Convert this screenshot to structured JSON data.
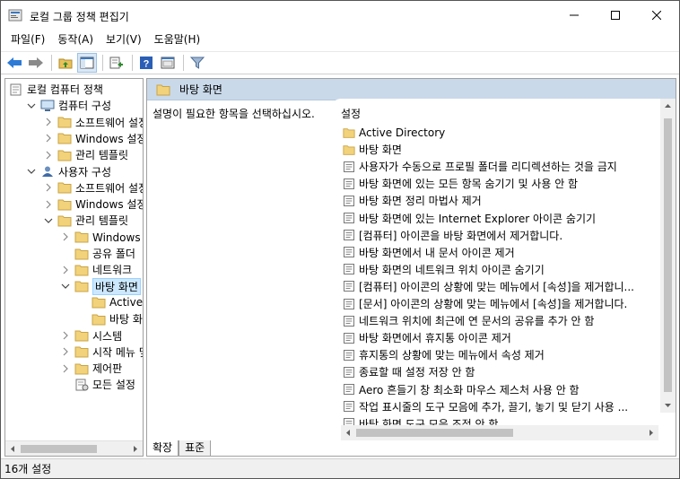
{
  "window": {
    "title": "로컬 그룹 정책 편집기"
  },
  "menu": [
    "파일(F)",
    "동작(A)",
    "보기(V)",
    "도움말(H)"
  ],
  "toolbar": {
    "icons": [
      "back-arrow-icon",
      "forward-arrow-icon",
      "up-folder-icon",
      "show-hide-tree-icon",
      "export-list-icon",
      "help-icon",
      "properties-icon",
      "filter-icon"
    ]
  },
  "tree": {
    "items": [
      {
        "label": "로컬 컴퓨터 정책",
        "indent": 0,
        "chev": "",
        "icon": "policy"
      },
      {
        "label": "컴퓨터 구성",
        "indent": 1,
        "chev": "down",
        "icon": "computer"
      },
      {
        "label": "소프트웨어 설정",
        "indent": 2,
        "chev": "right",
        "icon": "folder"
      },
      {
        "label": "Windows 설정",
        "indent": 2,
        "chev": "right",
        "icon": "folder"
      },
      {
        "label": "관리 템플릿",
        "indent": 2,
        "chev": "right",
        "icon": "folder"
      },
      {
        "label": "사용자 구성",
        "indent": 1,
        "chev": "down",
        "icon": "user"
      },
      {
        "label": "소프트웨어 설정",
        "indent": 2,
        "chev": "right",
        "icon": "folder"
      },
      {
        "label": "Windows 설정",
        "indent": 2,
        "chev": "right",
        "icon": "folder"
      },
      {
        "label": "관리 템플릿",
        "indent": 2,
        "chev": "down",
        "icon": "folder"
      },
      {
        "label": "Windows 구성",
        "indent": 3,
        "chev": "right",
        "icon": "folder"
      },
      {
        "label": "공유 폴더",
        "indent": 3,
        "chev": "",
        "icon": "folder"
      },
      {
        "label": "네트워크",
        "indent": 3,
        "chev": "right",
        "icon": "folder"
      },
      {
        "label": "바탕 화면",
        "indent": 3,
        "chev": "down",
        "icon": "folder",
        "selected": true
      },
      {
        "label": "Active Dir",
        "indent": 4,
        "chev": "",
        "icon": "folder"
      },
      {
        "label": "바탕 화면",
        "indent": 4,
        "chev": "",
        "icon": "folder"
      },
      {
        "label": "시스템",
        "indent": 3,
        "chev": "right",
        "icon": "folder"
      },
      {
        "label": "시작 메뉴 및",
        "indent": 3,
        "chev": "right",
        "icon": "folder"
      },
      {
        "label": "제어판",
        "indent": 3,
        "chev": "right",
        "icon": "folder"
      },
      {
        "label": "모든 설정",
        "indent": 3,
        "chev": "",
        "icon": "allsettings"
      }
    ]
  },
  "right": {
    "header": "바탕 화면",
    "description": "설명이 필요한 항목을 선택하십시오.",
    "list_header": "설정",
    "items": [
      {
        "label": "Active Directory",
        "icon": "folder"
      },
      {
        "label": "바탕 화면",
        "icon": "folder"
      },
      {
        "label": "사용자가 수동으로 프로필 폴더를 리디렉션하는 것을 금지",
        "icon": "setting"
      },
      {
        "label": "바탕 화면에 있는 모든 항목 숨기기 및 사용 안 함",
        "icon": "setting"
      },
      {
        "label": "바탕 화면 정리 마법사 제거",
        "icon": "setting"
      },
      {
        "label": "바탕 화면에 있는 Internet Explorer 아이콘 숨기기",
        "icon": "setting"
      },
      {
        "label": "[컴퓨터] 아이콘을 바탕 화면에서 제거합니다.",
        "icon": "setting"
      },
      {
        "label": "바탕 화면에서 내 문서 아이콘 제거",
        "icon": "setting"
      },
      {
        "label": "바탕 화면의 네트워크 위치 아이콘 숨기기",
        "icon": "setting"
      },
      {
        "label": "[컴퓨터] 아이콘의 상황에 맞는 메뉴에서 [속성]을 제거합니...",
        "icon": "setting"
      },
      {
        "label": "[문서] 아이콘의 상황에 맞는 메뉴에서 [속성]을 제거합니다.",
        "icon": "setting"
      },
      {
        "label": "네트워크 위치에 최근에 연 문서의 공유를 추가 안 함",
        "icon": "setting"
      },
      {
        "label": "바탕 화면에서 휴지통 아이콘 제거",
        "icon": "setting"
      },
      {
        "label": "휴지통의 상황에 맞는 메뉴에서 속성 제거",
        "icon": "setting"
      },
      {
        "label": "종료할 때 설정 저장 안 함",
        "icon": "setting"
      },
      {
        "label": "Aero 흔들기 창 최소화 마우스 제스처 사용 안 함",
        "icon": "setting"
      },
      {
        "label": "작업 표시줄의 도구 모음에 추가, 끌기, 놓기 및 닫기 사용 ...",
        "icon": "setting"
      },
      {
        "label": "바탕 화면 도구 모음 조정 안 함",
        "icon": "setting"
      }
    ]
  },
  "tabs": [
    "확장",
    "표준"
  ],
  "status": "16개 설정"
}
